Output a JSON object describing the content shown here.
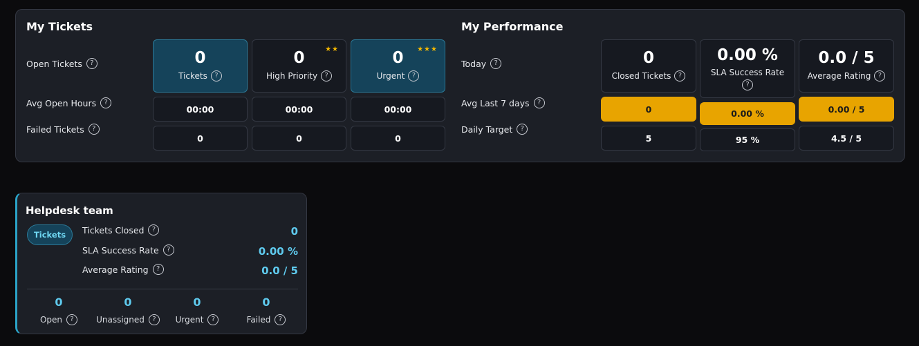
{
  "my_tickets": {
    "title": "My Tickets",
    "rows": {
      "open": "Open Tickets",
      "avg_hours": "Avg Open Hours",
      "failed": "Failed Tickets"
    },
    "cards": [
      {
        "value": "0",
        "label": "Tickets",
        "stars": ""
      },
      {
        "value": "0",
        "label": "High Priority",
        "stars": "★★"
      },
      {
        "value": "0",
        "label": "Urgent",
        "stars": "★★★"
      }
    ],
    "avg_hours": [
      "00:00",
      "00:00",
      "00:00"
    ],
    "failed": [
      "0",
      "0",
      "0"
    ]
  },
  "my_performance": {
    "title": "My Performance",
    "rows": {
      "today": "Today",
      "avg7": "Avg Last 7 days",
      "target": "Daily Target"
    },
    "cards": [
      {
        "value": "0",
        "label": "Closed Tickets"
      },
      {
        "value": "0.00 %",
        "label": "SLA Success Rate"
      },
      {
        "value": "0.0 / 5",
        "label": "Average Rating"
      }
    ],
    "avg7": [
      "0",
      "0.00 %",
      "0.00 / 5"
    ],
    "target": [
      "5",
      "95 %",
      "4.5 / 5"
    ]
  },
  "helpdesk": {
    "title": "Helpdesk team",
    "pill": "Tickets",
    "stats": [
      {
        "label": "Tickets Closed",
        "value": "0"
      },
      {
        "label": "SLA Success Rate",
        "value": "0.00 %"
      },
      {
        "label": "Average Rating",
        "value": "0.0 / 5"
      }
    ],
    "bottom": [
      {
        "value": "0",
        "label": "Open"
      },
      {
        "value": "0",
        "label": "Unassigned"
      },
      {
        "value": "0",
        "label": "Urgent"
      },
      {
        "value": "0",
        "label": "Failed"
      }
    ]
  },
  "icons": {
    "help": "?"
  },
  "colors": {
    "accent": "#5fcbef",
    "amber": "#e8a400",
    "teal": "#15435a"
  }
}
